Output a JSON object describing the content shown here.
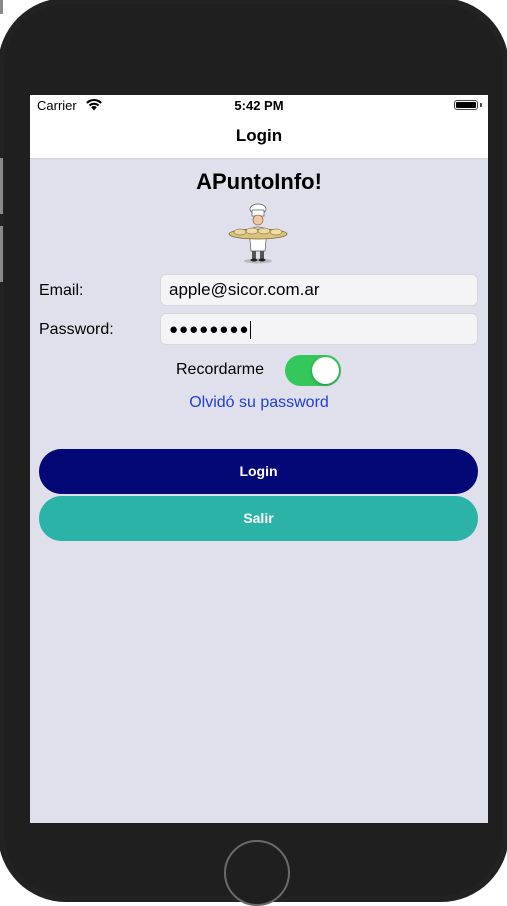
{
  "status_bar": {
    "carrier": "Carrier",
    "time": "5:42 PM",
    "icons": [
      "wifi-icon",
      "battery-icon"
    ]
  },
  "nav": {
    "title": "Login"
  },
  "app_title": "APuntoInfo!",
  "logo": {
    "icon": "chef-with-tray-logo"
  },
  "form": {
    "email_label": "Email:",
    "email_value": "apple@sicor.com.ar",
    "password_label": "Password:",
    "password_value": "●●●●●●●●",
    "remember_label": "Recordarme",
    "remember_on": true,
    "forgot_link": "Olvidó su password"
  },
  "buttons": {
    "login_label": "Login",
    "exit_label": "Salir"
  },
  "colors": {
    "screen_bg": "#e0e0ec",
    "login_button": "#040876",
    "exit_button": "#2cb3a8",
    "toggle_on": "#34c759",
    "link": "#1f3fd6"
  }
}
